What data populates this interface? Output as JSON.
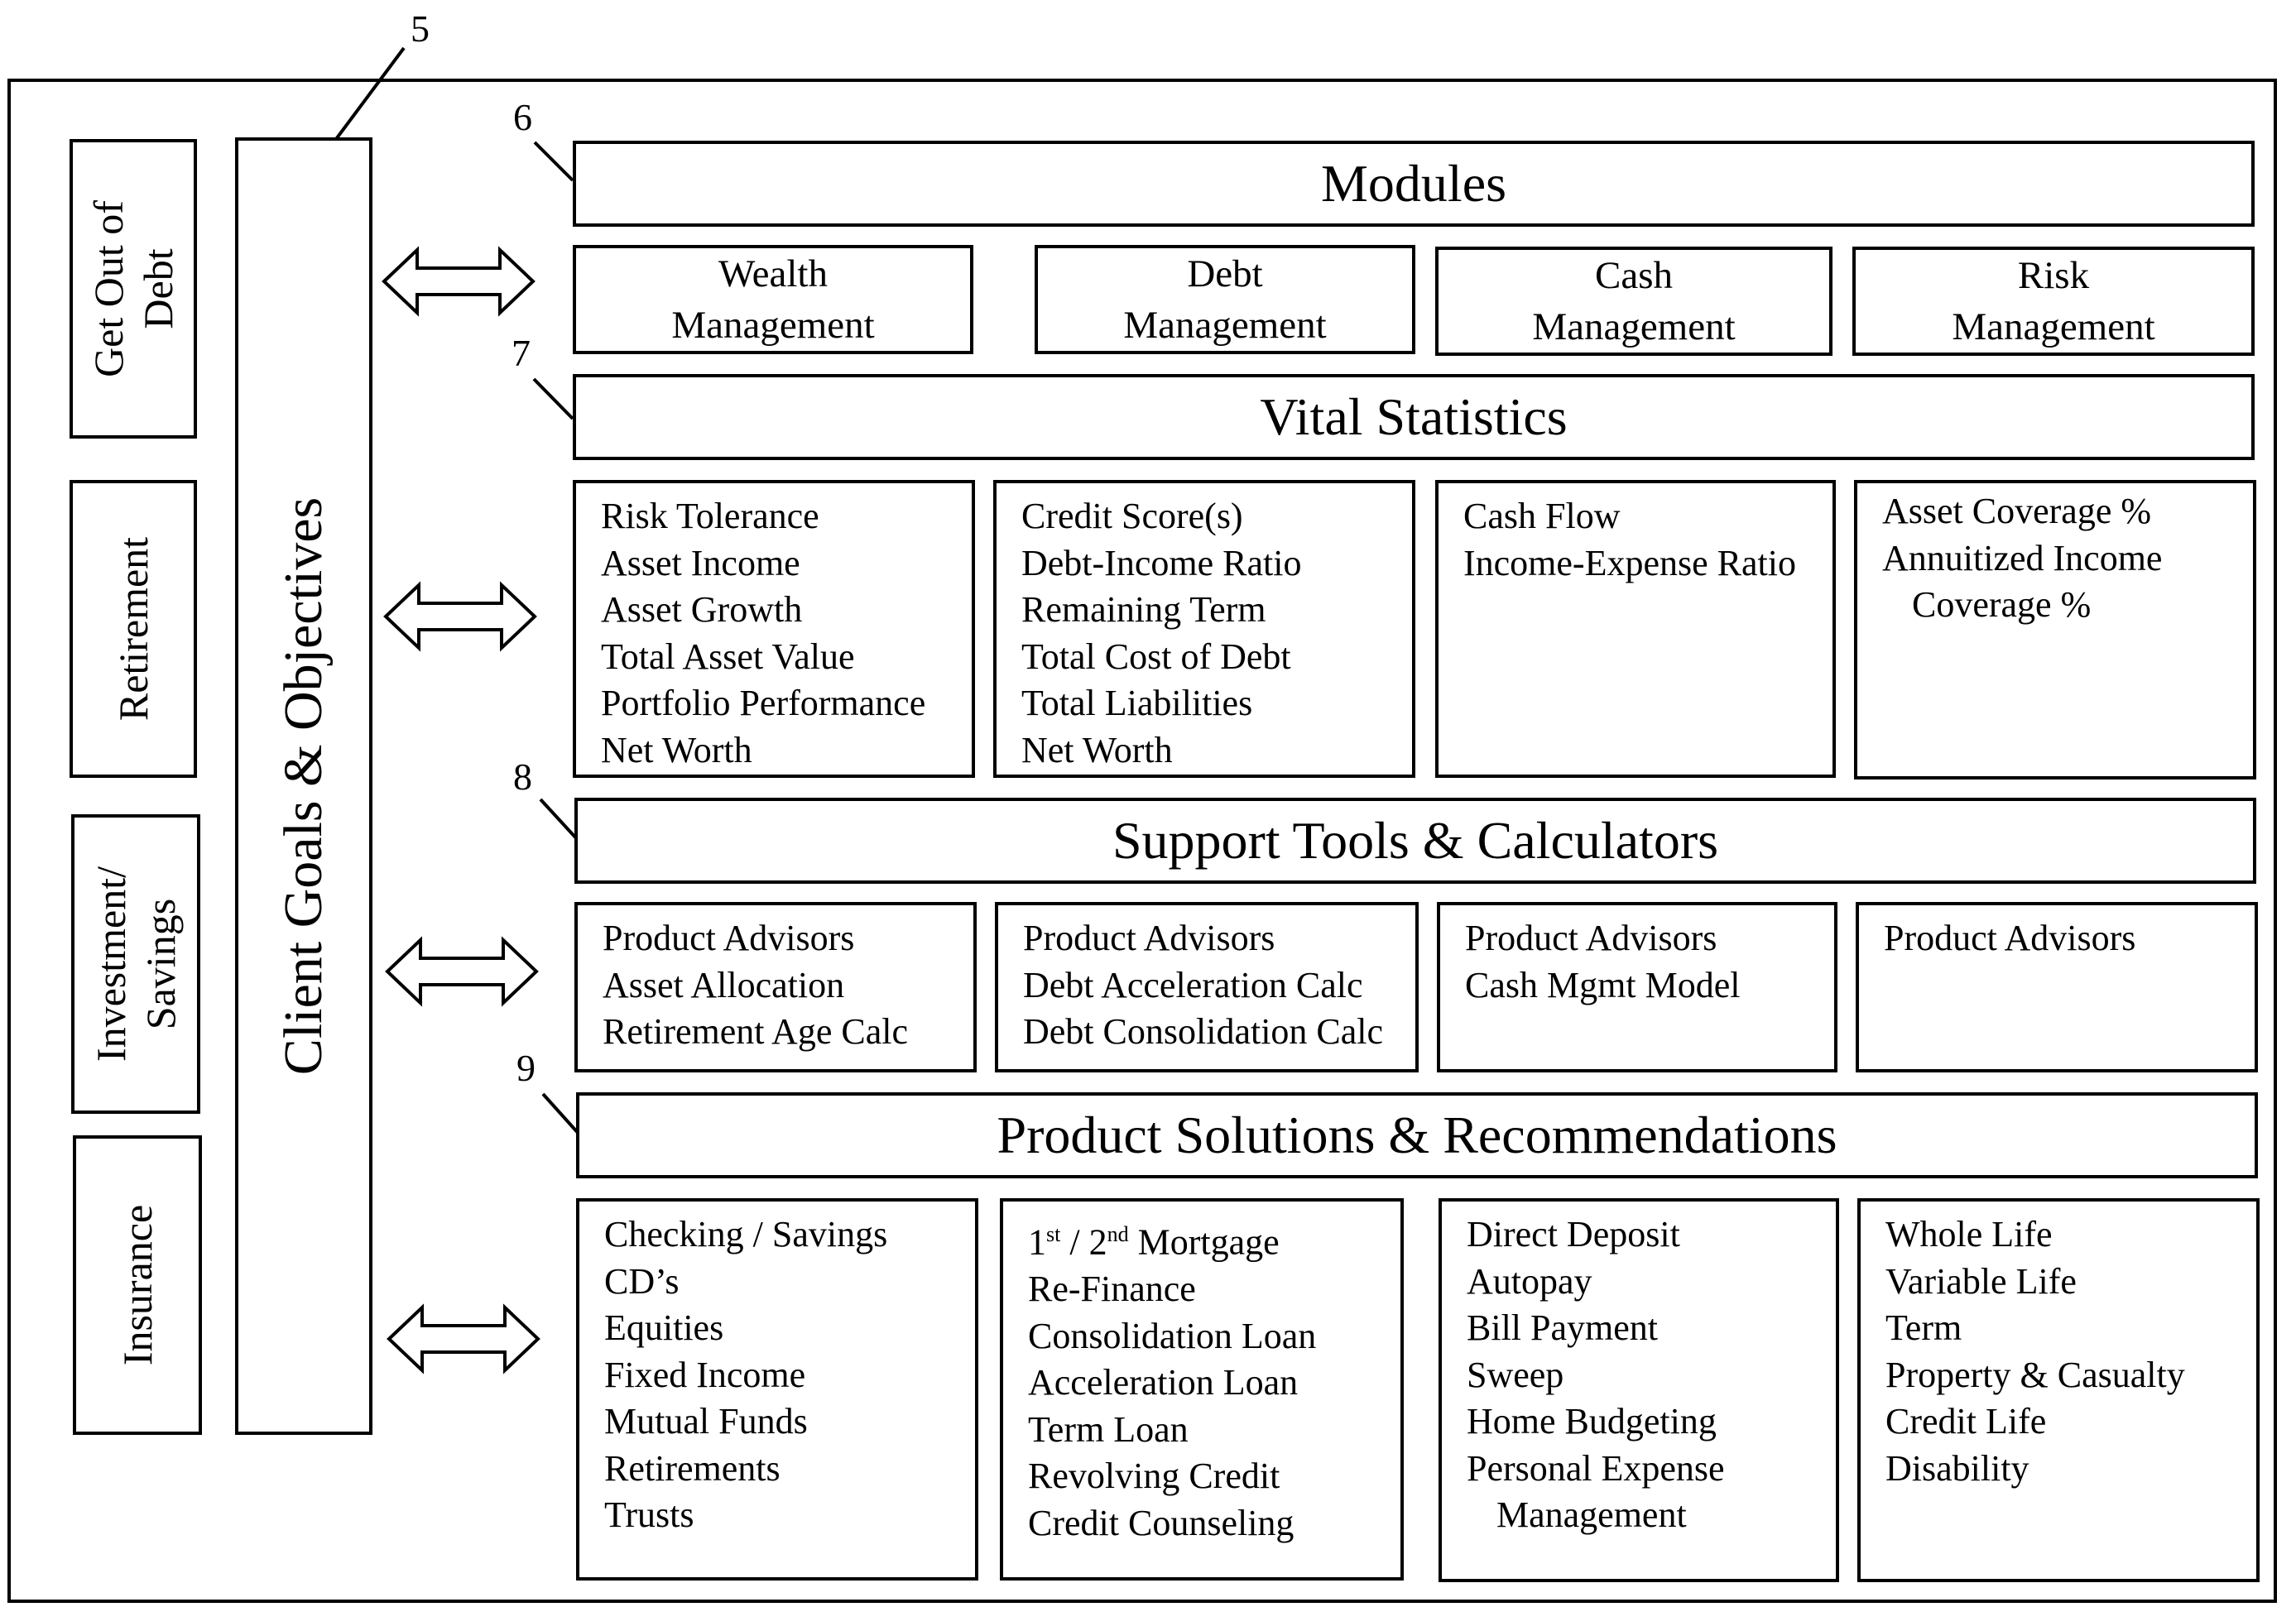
{
  "reference_numerals": {
    "client_goals": "5",
    "modules": "6",
    "vital_statistics": "7",
    "support_tools": "8",
    "product_solutions": "9"
  },
  "goals": [
    {
      "label_lines": [
        "Get Out of",
        "Debt"
      ]
    },
    {
      "label_lines": [
        "Retirement"
      ]
    },
    {
      "label_lines": [
        "Investment/",
        "Savings"
      ]
    },
    {
      "label_lines": [
        "Insurance"
      ]
    }
  ],
  "client_goals_label": "Client Goals & Objectives",
  "sections": {
    "modules": {
      "title": "Modules",
      "items": [
        {
          "line1": "Wealth",
          "line2": "Management"
        },
        {
          "line1": "Debt",
          "line2": "Management"
        },
        {
          "line1": "Cash",
          "line2": "Management"
        },
        {
          "line1": "Risk",
          "line2": "Management"
        }
      ]
    },
    "vital_statistics": {
      "title": "Vital Statistics",
      "columns": [
        [
          "Risk Tolerance",
          "Asset Income",
          "Asset Growth",
          "Total Asset Value",
          "Portfolio Performance",
          "Net Worth"
        ],
        [
          "Credit Score(s)",
          "Debt-Income Ratio",
          "Remaining Term",
          "Total Cost of Debt",
          "Total Liabilities",
          "Net Worth"
        ],
        [
          "Cash Flow",
          "Income-Expense Ratio"
        ],
        [
          "Asset Coverage %",
          "Annuitized Income",
          "Coverage %"
        ]
      ]
    },
    "support_tools": {
      "title": "Support Tools & Calculators",
      "columns": [
        [
          "Product Advisors",
          "Asset Allocation",
          "Retirement Age Calc"
        ],
        [
          "Product Advisors",
          "Debt Acceleration Calc",
          "Debt Consolidation Calc"
        ],
        [
          "Product Advisors",
          "Cash Mgmt Model"
        ],
        [
          "Product Advisors"
        ]
      ]
    },
    "product_solutions": {
      "title": "Product Solutions & Recommendations",
      "columns": [
        [
          "Checking / Savings",
          "CD’s",
          "Equities",
          "Fixed Income",
          "Mutual Funds",
          "Retirements",
          "Trusts"
        ],
        [
          "1st / 2nd Mortgage",
          "Re-Finance",
          "Consolidation Loan",
          "Acceleration Loan",
          "Term Loan",
          "Revolving Credit",
          "Credit Counseling"
        ],
        [
          "Direct Deposit",
          "Autopay",
          "Bill Payment",
          "Sweep",
          "Home Budgeting",
          "Personal Expense",
          "Management"
        ],
        [
          "Whole Life",
          "Variable Life",
          "Term",
          "Property & Casualty",
          "Credit Life",
          "Disability"
        ]
      ],
      "mortgage_parts": {
        "n1": "1",
        "sup1": "st",
        "mid": " / 2",
        "sup2": "nd",
        "tail": " Mortgage"
      }
    }
  }
}
